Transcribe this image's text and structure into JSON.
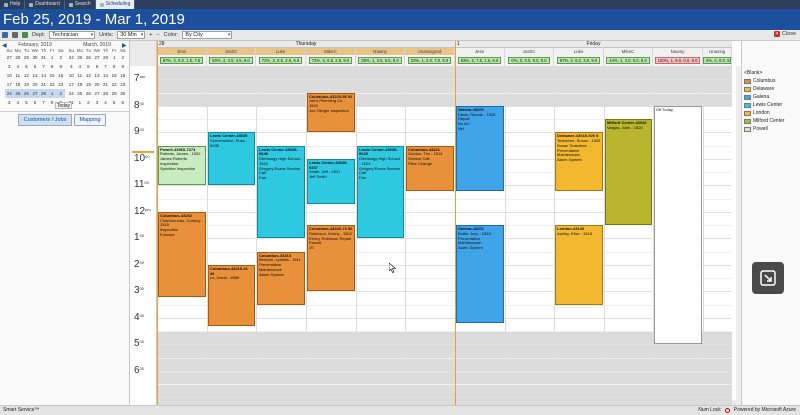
{
  "tabs": [
    {
      "label": "Help",
      "active": false
    },
    {
      "label": "Dashboard",
      "active": false
    },
    {
      "label": "Search",
      "active": false
    },
    {
      "label": "Scheduling",
      "active": true
    }
  ],
  "header": {
    "title": "Feb 25, 2019 - Mar 1, 2019"
  },
  "toolbar": {
    "dept_label": "Dept:",
    "dept_value": "Technician",
    "units_label": "Units:",
    "units_value": "30 Min",
    "color_label": "Color:",
    "color_value": "By City",
    "close_label": "Close"
  },
  "calendars": [
    {
      "month": "February, 2019",
      "dow": [
        "Su",
        "Mo",
        "Tu",
        "We",
        "Th",
        "Fr",
        "Sa"
      ],
      "days": [
        "27",
        "28",
        "29",
        "30",
        "31",
        "1",
        "2",
        "3",
        "4",
        "5",
        "6",
        "7",
        "8",
        "9",
        "10",
        "11",
        "12",
        "13",
        "14",
        "15",
        "16",
        "17",
        "18",
        "19",
        "20",
        "21",
        "22",
        "23",
        "24",
        "25",
        "26",
        "27",
        "28",
        "1",
        "2",
        "3",
        "4",
        "5",
        "6",
        "7",
        "8",
        "9"
      ]
    },
    {
      "month": "March, 2019",
      "dow": [
        "Su",
        "Mo",
        "Tu",
        "We",
        "Th",
        "Fr",
        "Sa"
      ],
      "days": [
        "24",
        "25",
        "26",
        "27",
        "28",
        "1",
        "2",
        "3",
        "4",
        "5",
        "6",
        "7",
        "8",
        "9",
        "10",
        "11",
        "12",
        "13",
        "14",
        "15",
        "16",
        "17",
        "18",
        "19",
        "20",
        "21",
        "22",
        "23",
        "24",
        "25",
        "26",
        "27",
        "28",
        "29",
        "30",
        "31",
        "1",
        "2",
        "3",
        "4",
        "5",
        "6"
      ]
    }
  ],
  "today_label": "Today",
  "left_buttons": {
    "customers_jobs": "Customers / Jobs",
    "mapping": "Mapping"
  },
  "days": [
    {
      "num": "28",
      "name": "Thursday"
    },
    {
      "num": "1",
      "name": "Friday"
    }
  ],
  "columns": [
    {
      "name": "Jess",
      "summary": "67%, 2, 6.0, 1.5, 7.5"
    },
    {
      "name": "JoshC",
      "summary": "50%, 2, 4.5, 4.5, 9.0"
    },
    {
      "name": "Luke",
      "summary": "72%, 2, 6.5, 2.5, 9.0"
    },
    {
      "name": "MikeC",
      "summary": "72%, 5, 6.5, 2.5, 9.0"
    },
    {
      "name": "Nawny",
      "summary": "39%, 1, 3.5, 5.5, 9.0"
    },
    {
      "name": "Unassigned",
      "summary": "22%, 1, 2.0, 7.0, 9.0"
    },
    {
      "name": "Jess",
      "summary": "83%, 2, 7.5, 1.5, 9.0"
    },
    {
      "name": "JoshC",
      "summary": "0%, 0, 0.0, 9.0, 9.0"
    },
    {
      "name": "Luke",
      "summary": "67%, 2, 6.0, 3.0, 9.0"
    },
    {
      "name": "MikeC",
      "summary": "44%, 1, 4.0, 5.0, 9.0"
    },
    {
      "name": "Nawny",
      "summary": "100%, 1, 9.0, 0.0, 9.0"
    },
    {
      "name": "Unassig",
      "summary": "0%, 0, 0.0, 9.0, 9.0"
    }
  ],
  "hours": [
    {
      "h": "7",
      "ampm": "am"
    },
    {
      "h": "8",
      "ampm": "00"
    },
    {
      "h": "9",
      "ampm": "00"
    },
    {
      "h": "10",
      "ampm": "00"
    },
    {
      "h": "11",
      "ampm": "00"
    },
    {
      "h": "12",
      "ampm": "pm"
    },
    {
      "h": "1",
      "ampm": "00"
    },
    {
      "h": "2",
      "ampm": "00"
    },
    {
      "h": "3",
      "ampm": "00"
    },
    {
      "h": "4",
      "ampm": "00"
    },
    {
      "h": "5",
      "ampm": "00"
    },
    {
      "h": "6",
      "ampm": "00"
    }
  ],
  "appointments": [
    {
      "col": 0,
      "start": 9.5,
      "end": 11.0,
      "color": "green",
      "title": "Powell-43965-7374",
      "lines": [
        "Roberts, James - 1552",
        "James Roberts Inspection",
        "Sprinkler Inspection"
      ]
    },
    {
      "col": 0,
      "start": 12.0,
      "end": 15.2,
      "color": "orange",
      "title": "Columbus-43232",
      "lines": [
        "Charbonneau, Cortney - 1515",
        "Inspection",
        "Furnace"
      ]
    },
    {
      "col": 1,
      "start": 9.0,
      "end": 11.0,
      "color": "cyan",
      "title": "Lewis Center-43035",
      "lines": [
        "Sonnenshein, Russ - 5035"
      ]
    },
    {
      "col": 1,
      "start": 14.0,
      "end": 16.3,
      "color": "orange",
      "title": "Columbus-43215-31 46",
      "lines": [
        "Le, David - 6556"
      ]
    },
    {
      "col": 2,
      "start": 9.5,
      "end": 13.0,
      "color": "cyan",
      "title": "Lewis Center-43035-9049",
      "lines": [
        "Olentangy High School - 1523",
        "Gregory Evans Service Call",
        "Fan"
      ]
    },
    {
      "col": 2,
      "start": 13.5,
      "end": 15.5,
      "color": "orange",
      "title": "Columbus-43213",
      "lines": [
        "Bedsole, Lynetta - 1511",
        "Preventative Maintenance",
        "Alarm System"
      ]
    },
    {
      "col": 3,
      "start": 7.5,
      "end": 9.0,
      "color": "orange",
      "title": "Columbus-43229-56 92",
      "lines": [
        "Joe's Plumbing Co. - 1503",
        "Joe Olinger Inspection"
      ]
    },
    {
      "col": 3,
      "start": 10.0,
      "end": 11.7,
      "color": "cyan",
      "title": "Lewis Center-43035-9437",
      "lines": [
        "Smith, Jeff - 1521",
        "Jeff Smith"
      ]
    },
    {
      "col": 3,
      "start": 12.5,
      "end": 15.0,
      "color": "orange",
      "title": "Columbus-43240-70 80",
      "lines": [
        "Robinson, Kenny - 1502",
        "Kenny Robinson Repair",
        "Faucet",
        "JS"
      ]
    },
    {
      "col": 4,
      "start": 9.5,
      "end": 13.0,
      "color": "cyan",
      "title": "Lewis Center-43035-9049",
      "lines": [
        "Olentangy High School - 1523",
        "Gregory Evans Service Call",
        "Fan"
      ]
    },
    {
      "col": 5,
      "start": 9.5,
      "end": 11.2,
      "color": "orange",
      "title": "Columbus-43221",
      "lines": [
        "Gordon, Tim - 1514",
        "Service Call",
        "Filter Change"
      ]
    },
    {
      "col": 6,
      "start": 8.0,
      "end": 11.2,
      "color": "blue",
      "title": "Galena-43201",
      "lines": [
        "Davis, Ronnie - 1525",
        "Repair",
        "No AC",
        "NH"
      ]
    },
    {
      "col": 6,
      "start": 12.5,
      "end": 16.2,
      "color": "blue",
      "title": "Galena-43201",
      "lines": [
        "Butler, Amy - 1516",
        "Preventative Maintenance",
        "Alarm System"
      ]
    },
    {
      "col": 8,
      "start": 9.0,
      "end": 11.2,
      "color": "yellow",
      "title": "Delaware-43015-920 8",
      "lines": [
        "Tedeshee, Susan - 1505",
        "Susan Tedeshee Preventative",
        "Maintenance",
        "Alarm System"
      ]
    },
    {
      "col": 8,
      "start": 12.5,
      "end": 15.5,
      "color": "yellow",
      "title": "London-43140",
      "lines": [
        "Ashley, Elise - 1518"
      ]
    },
    {
      "col": 9,
      "start": 8.5,
      "end": 12.5,
      "color": "olive",
      "title": "Milford Center-43040",
      "lines": [
        "Vargas, John - 1520"
      ]
    },
    {
      "col": 10,
      "start": 8.0,
      "end": 17.0,
      "color": "white",
      "title": "",
      "lines": [
        "Off Today"
      ]
    }
  ],
  "legend": [
    {
      "label": "<Blank>",
      "color": "#ffffff"
    },
    {
      "label": "Columbus",
      "color": "#e8913a"
    },
    {
      "label": "Delaware",
      "color": "#f2b830"
    },
    {
      "label": "Galena",
      "color": "#3fa3e8"
    },
    {
      "label": "Lewis Center",
      "color": "#2ec8e0"
    },
    {
      "label": "London",
      "color": "#f2b830"
    },
    {
      "label": "Milford Center",
      "color": "#b9b52c"
    },
    {
      "label": "Powell",
      "color": "#c8ecc0"
    }
  ],
  "status": {
    "left": "Smart Service™",
    "num_lock": "Num Lock",
    "powered": "Powered by Microsoft Azure"
  }
}
